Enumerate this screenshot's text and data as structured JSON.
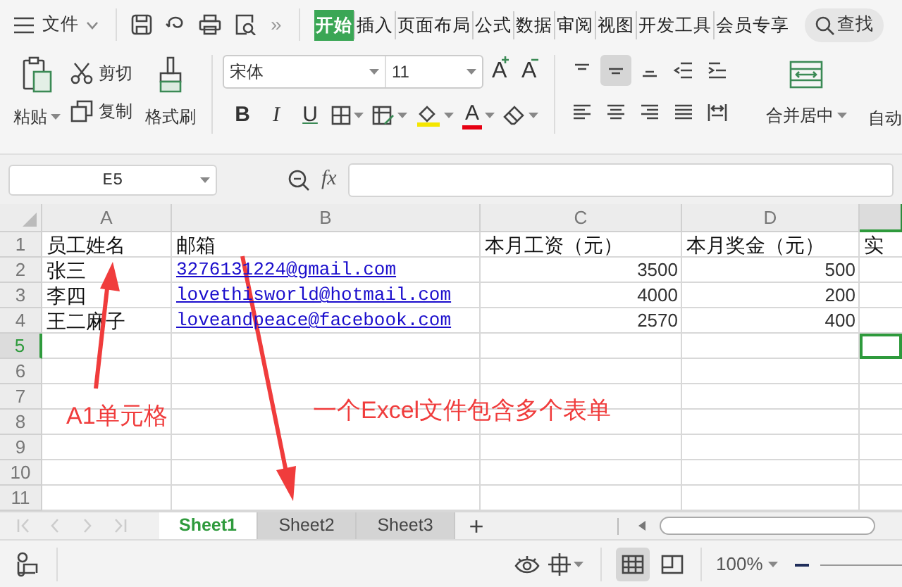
{
  "menu": {
    "label": "文件"
  },
  "overflow": "»",
  "tabs": [
    {
      "label": "开始",
      "selected": true
    },
    {
      "label": "插入",
      "selected": false
    },
    {
      "label": "页面布局",
      "selected": false
    },
    {
      "label": "公式",
      "selected": false
    },
    {
      "label": "数据",
      "selected": false
    },
    {
      "label": "审阅",
      "selected": false
    },
    {
      "label": "视图",
      "selected": false
    },
    {
      "label": "开发工具",
      "selected": false
    },
    {
      "label": "会员专享",
      "selected": false
    }
  ],
  "search": {
    "label": "查找"
  },
  "ribbon": {
    "clipboard": {
      "paste": "粘贴",
      "cut": "剪切",
      "copy": "复制",
      "format_painter": "格式刷"
    },
    "font": {
      "name": "宋体",
      "size": "11",
      "grow": "A",
      "shrink": "A",
      "styles": [
        "B",
        "I",
        "U"
      ],
      "font_color": "A"
    },
    "alignment": {
      "merge": "合并居中",
      "wrap": "自动"
    }
  },
  "formula_bar": {
    "name_box": "E5",
    "fx": "fx"
  },
  "columns": [
    {
      "label": "A",
      "selected": false
    },
    {
      "label": "B",
      "selected": false
    },
    {
      "label": "C",
      "selected": false
    },
    {
      "label": "D",
      "selected": false
    },
    {
      "selected": true
    }
  ],
  "rows": [
    {
      "number": "1",
      "selected": false,
      "cells": [
        {
          "kind": "text",
          "text": "员工姓名"
        },
        {
          "kind": "text",
          "text": "邮箱"
        },
        {
          "kind": "text",
          "text": "本月工资（元）"
        },
        {
          "kind": "text",
          "text": "本月奖金（元）"
        },
        {
          "kind": "text",
          "text": "实"
        }
      ]
    },
    {
      "number": "2",
      "selected": false,
      "cells": [
        {
          "kind": "text",
          "text": "张三"
        },
        {
          "kind": "link",
          "text": "3276131224@gmail.com"
        },
        {
          "kind": "number",
          "text": "3500"
        },
        {
          "kind": "number",
          "text": "500"
        }
      ]
    },
    {
      "number": "3",
      "selected": false,
      "cells": [
        {
          "kind": "text",
          "text": "李四"
        },
        {
          "kind": "link",
          "text": "lovethisworld@hotmail.com"
        },
        {
          "kind": "number",
          "text": "4000"
        },
        {
          "kind": "number",
          "text": "200"
        }
      ]
    },
    {
      "number": "4",
      "selected": false,
      "cells": [
        {
          "kind": "text",
          "text": "王二麻子"
        },
        {
          "kind": "link",
          "text": "loveandpeace@facebook.com"
        },
        {
          "kind": "number",
          "text": "2570"
        },
        {
          "kind": "number",
          "text": "400"
        }
      ]
    },
    {
      "number": "5",
      "selected": true
    },
    {
      "number": "6",
      "selected": false
    },
    {
      "number": "7",
      "selected": false
    },
    {
      "number": "8",
      "selected": false
    },
    {
      "number": "9",
      "selected": false
    },
    {
      "number": "10",
      "selected": false
    },
    {
      "number": "11",
      "selected": false
    }
  ],
  "sheets": [
    {
      "label": "Sheet1",
      "selected": true
    },
    {
      "label": "Sheet2",
      "selected": false
    },
    {
      "label": "Sheet3",
      "selected": false
    }
  ],
  "add_sheet": "+",
  "status_bar": {
    "zoom": "100%"
  },
  "annotations": [
    {
      "text": "A1单元格"
    },
    {
      "text": "一个Excel文件包含多个表单"
    }
  ]
}
